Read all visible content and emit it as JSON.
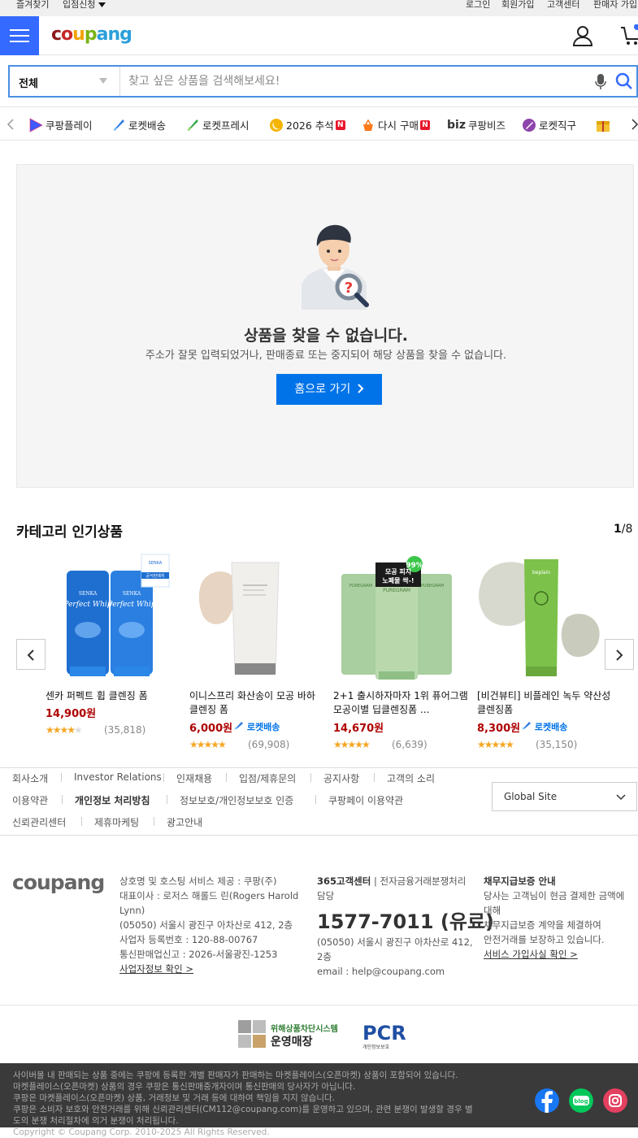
{
  "topbar": {
    "favorites": "즐겨찾기",
    "seller_apply": "입점신청",
    "login": "로그인",
    "signup": "회원가입",
    "cs": "고객센터",
    "seller_join": "판매자 가입"
  },
  "header": {
    "logo_text": "coupang"
  },
  "search": {
    "category": "전체",
    "placeholder": "찾고 싶은 상품을 검색해보세요!"
  },
  "nav": {
    "items": [
      {
        "label": "쿠팡플레이",
        "icon": "coupang-play-icon"
      },
      {
        "label": "로켓배송",
        "icon": "rocket-icon"
      },
      {
        "label": "로켓프레시",
        "icon": "rocket-fresh-icon"
      },
      {
        "label": "2026 추석",
        "icon": "chuseok-icon",
        "badge": "N"
      },
      {
        "label": "다시 구매",
        "icon": "rebuy-icon",
        "badge": "N"
      },
      {
        "label": "쿠팡비즈",
        "icon": "biz-icon",
        "prefix": "biz"
      },
      {
        "label": "로켓직구",
        "icon": "rocket-global-icon"
      }
    ]
  },
  "not_found": {
    "title": "상품을 찾을 수 없습니다.",
    "description": "주소가 잘못 입력되었거나, 판매종료 또는 중지되어 해당 상품을 찾을 수 없습니다.",
    "home_button": "홈으로 가기"
  },
  "category": {
    "title": "카테고리 인기상품",
    "page_current": "1",
    "page_total": "/8"
  },
  "products": [
    {
      "name": "센카 퍼펙트 휩 클렌징 폼",
      "price": "14,900원",
      "rocket": "",
      "rating": 4.5,
      "reviews": "(35,818)"
    },
    {
      "name": "이니스프리 화산송이 모공 바하 클렌징 폼",
      "price": "6,000원",
      "rocket": "로켓배송",
      "rating": 5,
      "reviews": "(69,908)"
    },
    {
      "name": "2+1 출시하자마자 1위 퓨어그램 모공이별 딥클렌징폼 ...",
      "price": "14,670원",
      "rocket": "",
      "rating": 5,
      "reviews": "(6,639)"
    },
    {
      "name": "[비건뷰티] 비플레인 녹두 약산성 클렌징폼",
      "price": "8,300원",
      "rocket": "로켓배송",
      "rating": 5,
      "reviews": "(35,150)"
    }
  ],
  "product_image_texts": {
    "senka_brand": "SENKA",
    "senka_product": "Perfect Whip",
    "senka_badge": "공식판매처",
    "puregram_badge_line1": "모공 피지",
    "puregram_badge_line2": "노폐물 싹-!",
    "puregram_badge_pct": "99%",
    "puregram_brand": "PUREGRAM",
    "beplain_brand": "beplain"
  },
  "footer_links": {
    "row1": [
      "회사소개",
      "Investor Relations",
      "인재채용",
      "입점/제휴문의",
      "공지사항",
      "고객의 소리"
    ],
    "row2": [
      "이용약관",
      "개인정보 처리방침",
      "정보보호/개인정보보호 인증",
      "쿠팡페이 이용약관"
    ],
    "row3": [
      "신뢰관리센터",
      "제휴마케팅",
      "광고안내"
    ],
    "global_site": "Global Site"
  },
  "company": {
    "logo_text": "coupang",
    "lines": [
      "상호명 및 호스팅 서비스 제공 : 쿠팡(주)",
      "대표이사 : 로저스 해롤드 린(Rogers Harold",
      "Lynn)",
      "(05050) 서울시 광진구 아차산로 412, 2층",
      "사업자 등록번호 : 120-88-00767",
      "통신판매업신고 : 2026-서울광진-1253"
    ],
    "biz_info_link": "사업자정보 확인 >"
  },
  "cs": {
    "title": "365고객센터",
    "title2": " | 전자금융거래분쟁처리",
    "title3": "담당",
    "phone": "1577-7011 (유료)",
    "address": "(05050) 서울시 광진구 아차산로 412,",
    "address2": "2층",
    "email": "email : help@coupang.com"
  },
  "guarantee": {
    "title": "채무지급보증 안내",
    "lines": [
      "당사는 고객님이 현금 결제한 금액에",
      "대해",
      "채무지급보증 계약을 체결하여",
      "안전거래를 보장하고 있습니다."
    ],
    "link": "서비스 가입사실 확인 >"
  },
  "certs": {
    "cert1_line1": "위해상품차단시스템",
    "cert1_line2": "운영매장",
    "cert2": "PCR",
    "cert2_sub": "개인정보보호"
  },
  "legal": {
    "lines": [
      "사이버몰 내 판매되는 상품 중에는 쿠팡에 등록한 개별 판매자가 판매하는 마켓플레이스(오픈마켓) 상품이 포함되어 있습니다.",
      "마켓플레이스(오픈마켓) 상품의 경우 쿠팡은 통신판매중개자이며 통신판매의 당사자가 아닙니다.",
      "쿠팡은 마켓플레이스(오픈마켓) 상품, 거래정보 및 거래 등에 대하여 책임을 지지 않습니다.",
      "쿠팡은 소비자 보호와 안전거래를 위해 신뢰관리센터(CM112@coupang.com)를 운영하고 있으며, 관련 분쟁이 발생할 경우 별",
      "도의 분쟁 처리절차에 의거 분쟁이 처리됩니다.",
      "Copyright © Coupang Corp. 2010-2025 All Rights Reserved."
    ]
  },
  "social": {
    "blog_label": "blog"
  },
  "colors": {
    "accent": "#346aff",
    "button": "#0073e9",
    "price": "#ae0000",
    "star": "#f5a623"
  }
}
